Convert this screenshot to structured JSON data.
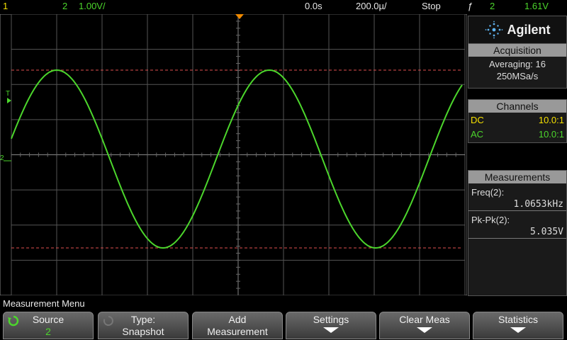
{
  "topbar": {
    "ch1": "1",
    "ch2": "2",
    "volts": "1.00V/",
    "delay": "0.0s",
    "timebase": "200.0µ/",
    "run_state": "Stop",
    "trig_icon": "ƒ",
    "trig_source": "2",
    "trig_level": "1.61V"
  },
  "scope": {
    "trigger_marker": "T",
    "ground_marker": "2",
    "trace_color": "#4cd62c",
    "cursor_color": "#e05050"
  },
  "panel": {
    "brand": "Agilent",
    "acquisition": {
      "title": "Acquisition",
      "mode": "Averaging: 16",
      "rate": "250MSa/s"
    },
    "channels": {
      "title": "Channels",
      "ch1_coupling": "DC",
      "ch1_probe": "10.0:1",
      "ch2_coupling": "AC",
      "ch2_probe": "10.0:1"
    },
    "measurements": {
      "title": "Measurements",
      "m1_label": "Freq(2):",
      "m1_value": "1.0653kHz",
      "m2_label": "Pk-Pk(2):",
      "m2_value": "5.035V"
    }
  },
  "menu": {
    "title": "Measurement Menu",
    "keys": [
      {
        "l1": "Source",
        "l2": "2"
      },
      {
        "l1": "Type:",
        "l2": "Snapshot"
      },
      {
        "l1": "Add",
        "l2": "Measurement"
      },
      {
        "l1": "Settings",
        "l2": ""
      },
      {
        "l1": "Clear Meas",
        "l2": ""
      },
      {
        "l1": "Statistics",
        "l2": ""
      }
    ]
  }
}
